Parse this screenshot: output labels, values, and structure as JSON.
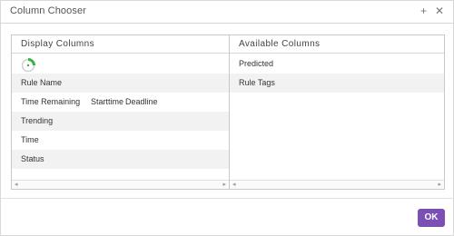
{
  "dialog": {
    "title": "Column Chooser",
    "plus_icon": "+",
    "close_icon": "✕",
    "ok_label": "OK"
  },
  "display_columns": {
    "header": "Display Columns",
    "items": [
      "Rule Name",
      "Time Remaining",
      "Starttime",
      "Deadline",
      "Trending",
      "Time",
      "Status"
    ]
  },
  "available_columns": {
    "header": "Available Columns",
    "items": [
      "Predicted",
      "Rule Tags"
    ]
  },
  "scroll": {
    "left_arrow": "◂",
    "right_arrow": "▸"
  },
  "colors": {
    "accent": "#7b4fb4",
    "spinner": "#3cb043"
  }
}
